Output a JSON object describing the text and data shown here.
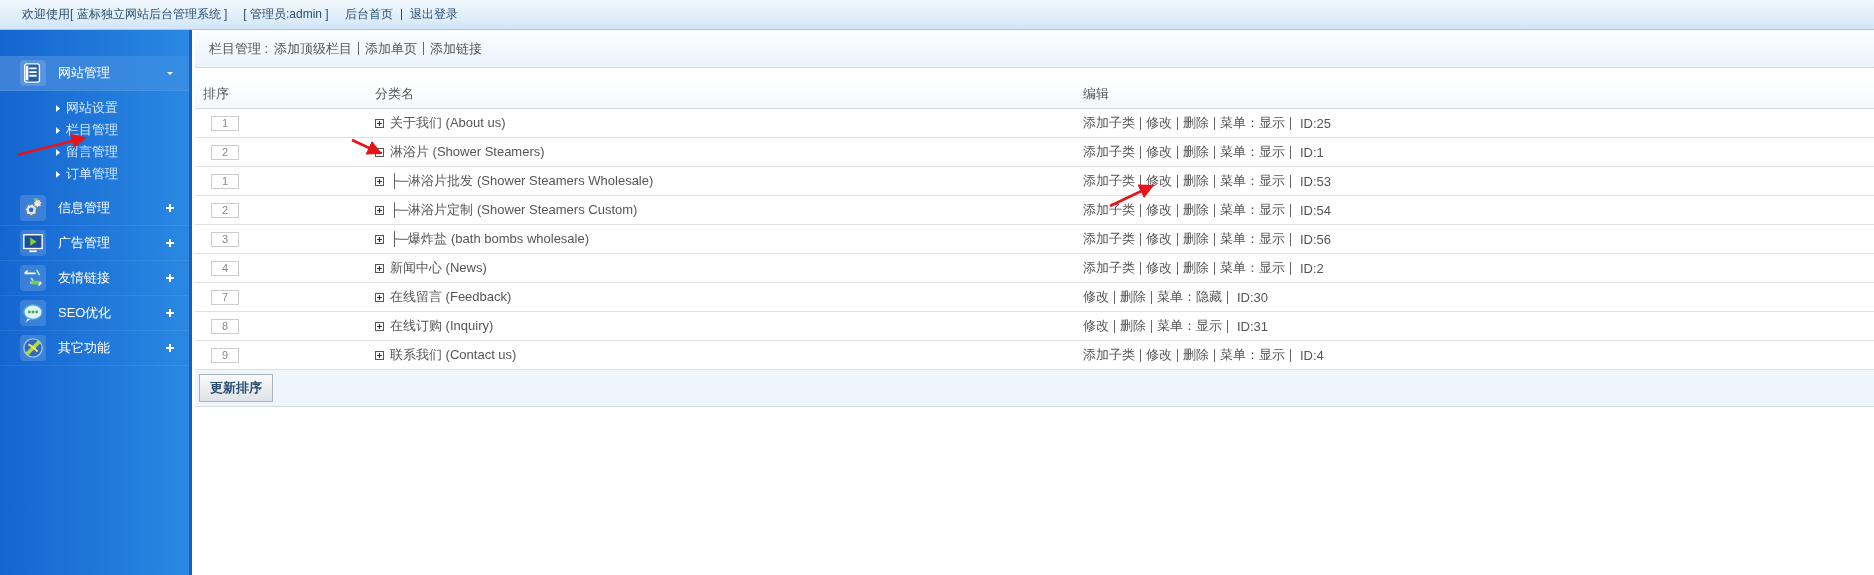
{
  "top_bar": {
    "welcome": "欢迎使用[ 蓝标独立网站后台管理系统 ]",
    "admin": "[ 管理员:admin ]",
    "links": [
      "后台首页",
      "退出登录"
    ]
  },
  "sidebar": {
    "groups": [
      {
        "label": "网站管理",
        "expanded": true,
        "items": [
          "网站设置",
          "栏目管理",
          "留言管理",
          "订单管理"
        ]
      },
      {
        "label": "信息管理",
        "expanded": false
      },
      {
        "label": "广告管理",
        "expanded": false
      },
      {
        "label": "友情链接",
        "expanded": false
      },
      {
        "label": "SEO优化",
        "expanded": false
      },
      {
        "label": "其它功能",
        "expanded": false
      }
    ]
  },
  "breadcrumb": {
    "title": "栏目管理 :",
    "links": [
      "添加顶级栏目",
      "添加单页",
      "添加链接"
    ]
  },
  "table": {
    "columns": [
      "排序",
      "分类名",
      "编辑"
    ],
    "rows": [
      {
        "order": "1",
        "expanded": false,
        "name": "关于我们  (About us)",
        "actions": [
          "添加子类",
          "修改",
          "删除",
          "菜单：显示"
        ],
        "id": "ID:25"
      },
      {
        "order": "2",
        "expanded": true,
        "name": "淋浴片  (Shower Steamers)",
        "actions": [
          "添加子类",
          "修改",
          "删除",
          "菜单：显示"
        ],
        "id": "ID:1",
        "children": [
          {
            "order": "1",
            "expanded": false,
            "name": "├─淋浴片批发  (Shower Steamers Wholesale)",
            "actions": [
              "添加子类",
              "修改",
              "删除",
              "菜单：显示"
            ],
            "id": "ID:53"
          },
          {
            "order": "2",
            "expanded": false,
            "name": "├─淋浴片定制  (Shower Steamers Custom)",
            "actions": [
              "添加子类",
              "修改",
              "删除",
              "菜单：显示"
            ],
            "id": "ID:54"
          },
          {
            "order": "3",
            "expanded": false,
            "name": "├─爆炸盐  (bath bombs wholesale)",
            "actions": [
              "添加子类",
              "修改",
              "删除",
              "菜单：显示"
            ],
            "id": "ID:56"
          }
        ]
      },
      {
        "order": "4",
        "expanded": false,
        "name": "新闻中心  (News)",
        "actions": [
          "添加子类",
          "修改",
          "删除",
          "菜单：显示"
        ],
        "id": "ID:2"
      },
      {
        "order": "7",
        "expanded": false,
        "name": "在线留言  (Feedback)",
        "actions": [
          "修改",
          "删除",
          "菜单：隐藏"
        ],
        "id": "ID:30"
      },
      {
        "order": "8",
        "expanded": false,
        "name": "在线订购  (Inquiry)",
        "actions": [
          "修改",
          "删除",
          "菜单：显示"
        ],
        "id": "ID:31"
      },
      {
        "order": "9",
        "expanded": false,
        "name": "联系我们  (Contact us)",
        "actions": [
          "添加子类",
          "修改",
          "删除",
          "菜单：显示"
        ],
        "id": "ID:4"
      }
    ],
    "button": "更新排序"
  }
}
